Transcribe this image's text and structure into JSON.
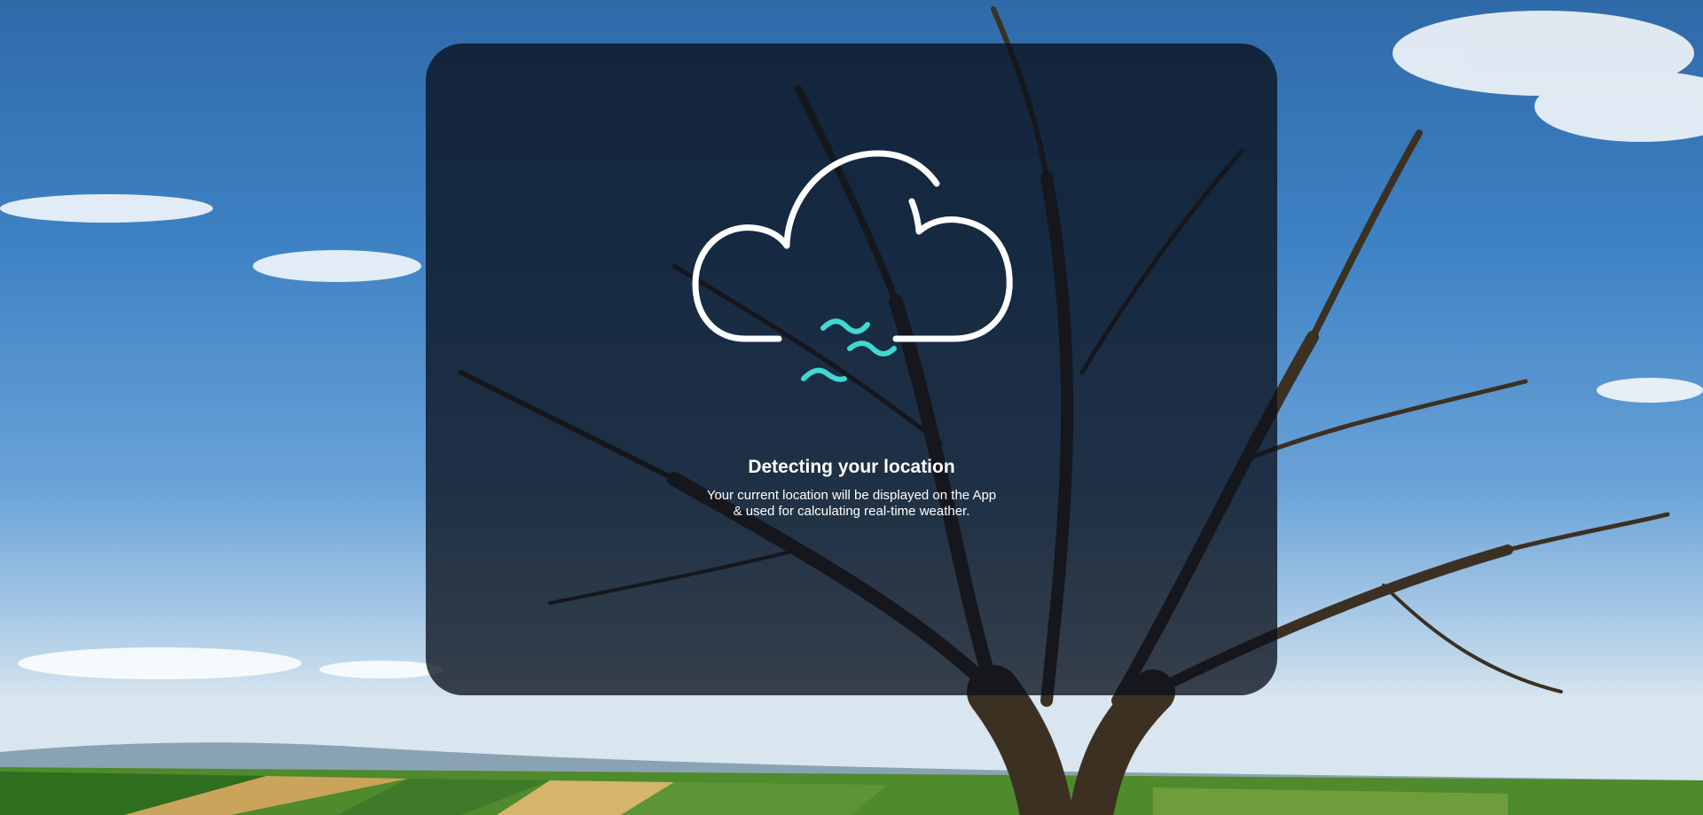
{
  "loading": {
    "title": "Detecting your location",
    "subtitle_line1": "Your current location will be displayed on the App",
    "subtitle_line2": "& used for calculating real-time weather."
  },
  "icons": {
    "main": "cloud-wind-icon"
  },
  "colors": {
    "overlay": "#0a111c",
    "cloud_outline": "#ffffff",
    "wind_accent": "#3fd9d2",
    "sky_top": "#2f6aa8",
    "field_green": "#3f7a2a"
  }
}
